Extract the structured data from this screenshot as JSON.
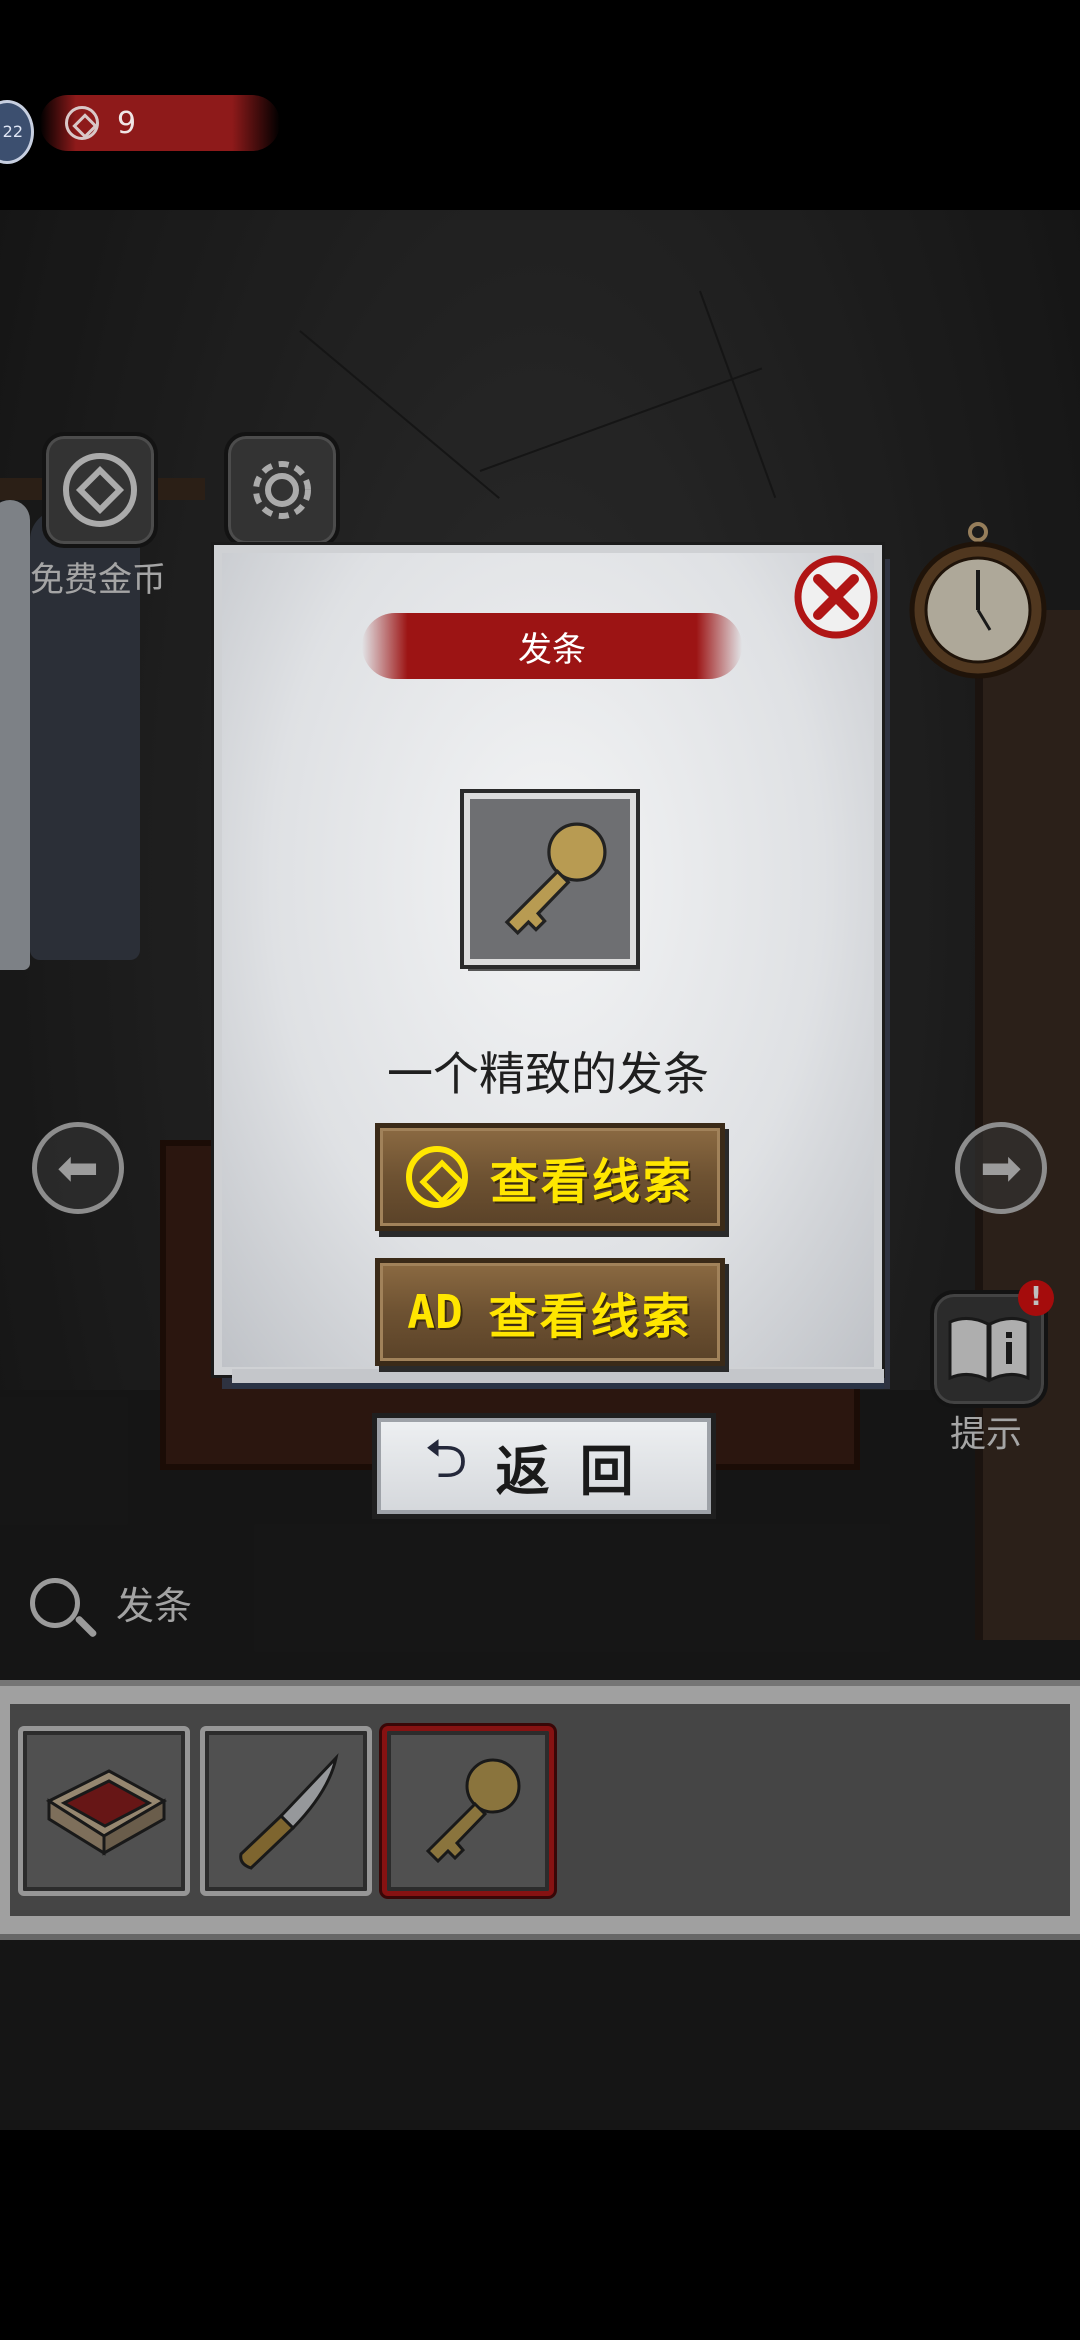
{
  "status": {
    "coin_count": "9",
    "level_badge": "22"
  },
  "top_buttons": {
    "free_coins_label": "免费金币"
  },
  "dialog": {
    "title": "发条",
    "description": "一个精致的发条",
    "coin_clue_label": "查看线索",
    "ad_prefix": "AD",
    "ad_clue_label": "查看线索"
  },
  "return_button": {
    "label": "返回"
  },
  "hint_button": {
    "label": "提示",
    "alert": "!"
  },
  "selected_item": {
    "label": "发条"
  },
  "inventory": {
    "items": [
      {
        "name": "matchbox"
      },
      {
        "name": "knife"
      },
      {
        "name": "clockwork-key",
        "selected": true
      }
    ]
  },
  "colors": {
    "accent_red": "#9c1414",
    "button_text_yellow": "#ffe600",
    "wood": "#6e5232"
  }
}
